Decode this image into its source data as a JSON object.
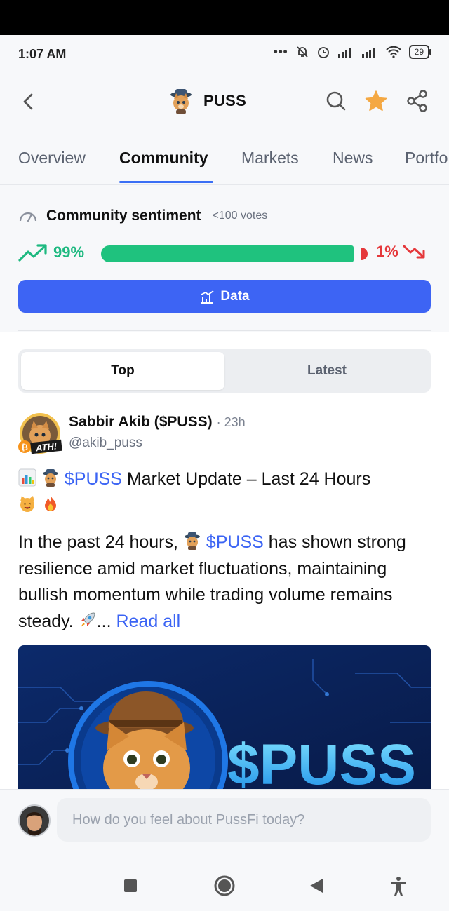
{
  "status": {
    "time": "1:07 AM",
    "battery": "29"
  },
  "header": {
    "title": "PUSS"
  },
  "tabs": [
    "Overview",
    "Community",
    "Markets",
    "News",
    "Portfo"
  ],
  "sentiment": {
    "title": "Community sentiment",
    "votes": "<100 votes",
    "bullish_pct": "99%",
    "bearish_pct": "1%",
    "bullish_fraction": 0.99,
    "data_button": "Data"
  },
  "feed_tabs": {
    "top": "Top",
    "latest": "Latest"
  },
  "post": {
    "author": "Sabbir Akib ($PUSS)",
    "time": "· 23h",
    "handle": "@akib_puss",
    "title_ticker": "$PUSS",
    "title_text": " Market Update – Last 24 Hours",
    "body_pre": "In the past 24 hours, ",
    "body_ticker": "$PUSS",
    "body_text": " has shown strong resilience amid market fluctuations, maintaining bullish momentum while trading volume remains steady. ",
    "ellipsis": "...",
    "read_all": "Read all",
    "image_text": "$PUSS",
    "badge_text": "ATH!"
  },
  "comment": {
    "placeholder": "How do you feel about PussFi today?"
  },
  "colors": {
    "accent": "#3d64f4",
    "bull": "#1fc27e",
    "bear": "#e5383b",
    "star": "#f4a843"
  },
  "icons": [
    "back-icon",
    "search-icon",
    "star-icon",
    "share-icon",
    "gauge-icon",
    "trend-up-icon",
    "trend-down-icon",
    "chart-icon",
    "rocket-icon",
    "bar-chart-emoji",
    "cat-emoji",
    "fire-emoji"
  ]
}
